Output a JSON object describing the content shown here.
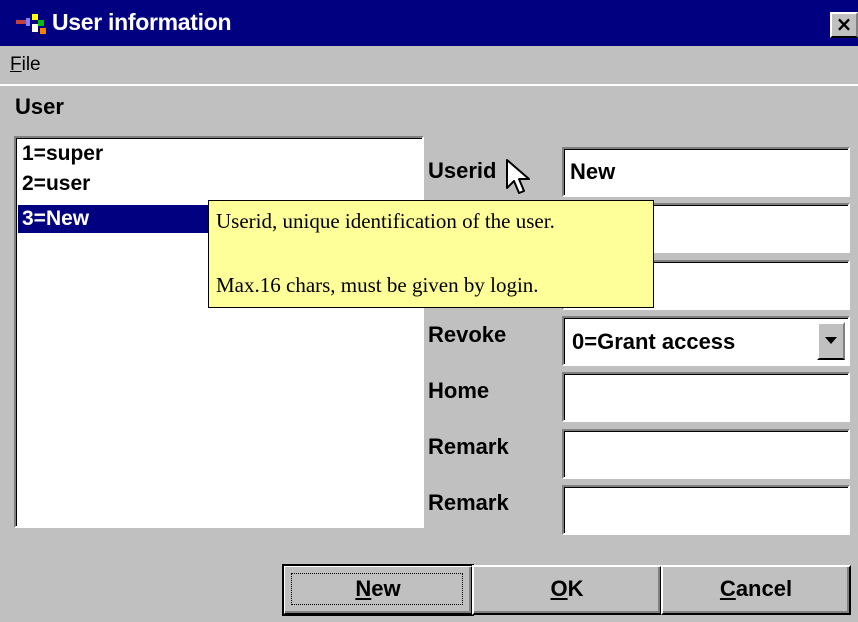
{
  "window": {
    "title": "User information",
    "close_label": "×"
  },
  "menu": {
    "items": [
      {
        "label": "File",
        "mnemonic": "F",
        "rest": "ile"
      }
    ]
  },
  "section": {
    "label": "User"
  },
  "user_list": {
    "items": [
      {
        "label": "1=super",
        "selected": false
      },
      {
        "label": "2=user",
        "selected": false
      },
      {
        "label": "3=New",
        "selected": true
      }
    ]
  },
  "form": {
    "userid_label": "Userid",
    "userid_value": "New",
    "field2_value": "",
    "field3_value": "",
    "revoke_label": "Revoke",
    "revoke_value": "0=Grant access",
    "home_label": "Home",
    "home_value": "",
    "remark1_label": "Remark",
    "remark1_value": "",
    "remark2_label": "Remark",
    "remark2_value": ""
  },
  "tooltip": {
    "line1": "Userid, unique identification of the user.",
    "line2": "Max.16 chars, must be given by login."
  },
  "buttons": {
    "new": {
      "label": "New",
      "mnemonic": "N",
      "rest": "ew"
    },
    "ok": {
      "label": "OK",
      "mnemonic": "O",
      "rest": "K"
    },
    "cancel": {
      "label": "Cancel",
      "mnemonic": "C",
      "rest": "ancel"
    }
  },
  "colors": {
    "titlebar": "#000080",
    "face": "#c0c0c0",
    "selection": "#000080",
    "tooltip_bg": "#ffff99"
  },
  "icons": [
    "app-icon",
    "close-icon",
    "dropdown-arrow-icon",
    "mouse-pointer-icon"
  ]
}
